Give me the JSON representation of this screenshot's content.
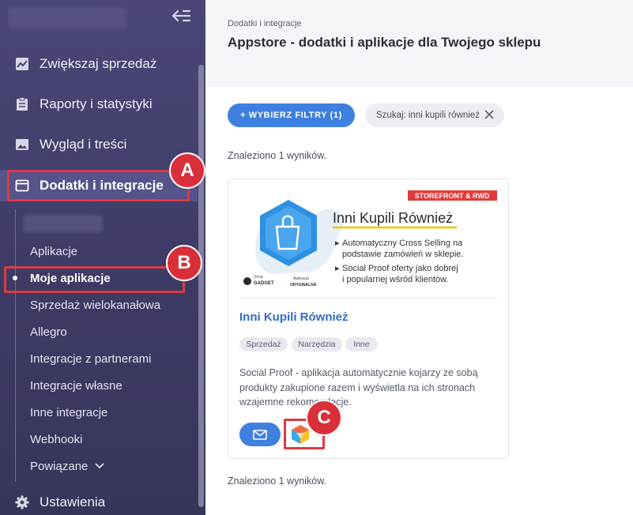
{
  "sidebar": {
    "main_items": [
      {
        "label": "Zwiększaj sprzedaż",
        "icon": "chart-line-icon"
      },
      {
        "label": "Raporty i statystyki",
        "icon": "clipboard-icon"
      },
      {
        "label": "Wygląd i treści",
        "icon": "image-icon"
      },
      {
        "label": "Dodatki i integracje",
        "icon": "window-icon"
      }
    ],
    "sub_items": [
      {
        "label": "Aplikacje"
      },
      {
        "label": "Moje aplikacje"
      },
      {
        "label": "Sprzedaż wielokanałowa"
      },
      {
        "label": "Allegro"
      },
      {
        "label": "Integracje z partnerami"
      },
      {
        "label": "Integracje własne"
      },
      {
        "label": "Inne integracje"
      },
      {
        "label": "Webhooki"
      },
      {
        "label": "Powiązane"
      }
    ],
    "settings_label": "Ustawienia"
  },
  "header": {
    "breadcrumb": "Dodatki i integracje",
    "title": "Appstore - dodatki i aplikacje dla Twojego sklepu"
  },
  "filters": {
    "filter_button": "+ WYBIERZ FILTRY (1)",
    "search_chip": "Szukaj: inni kupili również"
  },
  "results": {
    "found_top": "Znaleziono 1 wyników.",
    "found_bottom": "Znaleziono 1 wyników."
  },
  "app_card": {
    "banner": {
      "ribbon": "STOREFRONT & RWD",
      "headline": "Inni Kupili Również",
      "bullet1_line1": "Automatyczny Cross Selling na",
      "bullet1_line2": "podstawie zamówień w sklepie.",
      "bullet2_line1": "Social Proof oferty jako dobrej",
      "bullet2_line2": "i popularnej wśród klientów.",
      "brand_small": "Shop",
      "brand_name": "GADGET",
      "badge_small": "Aplikacja",
      "badge_name": "ORYGINALNA"
    },
    "name": "Inni Kupili Również",
    "tags": [
      "Sprzedaż",
      "Narzędzia",
      "Inne"
    ],
    "description": "Social Proof - aplikacja automatycznie kojarzy ze sobą produkty zakupione razem i wyświetla na ich stronach wzajemne rekomendacje."
  },
  "annotations": {
    "a": "A",
    "b": "B",
    "c": "C"
  },
  "colors": {
    "sidebar": "#433f70",
    "accent": "#3e7fe0",
    "annotation": "#dc3b42",
    "link": "#2f6cc7"
  }
}
